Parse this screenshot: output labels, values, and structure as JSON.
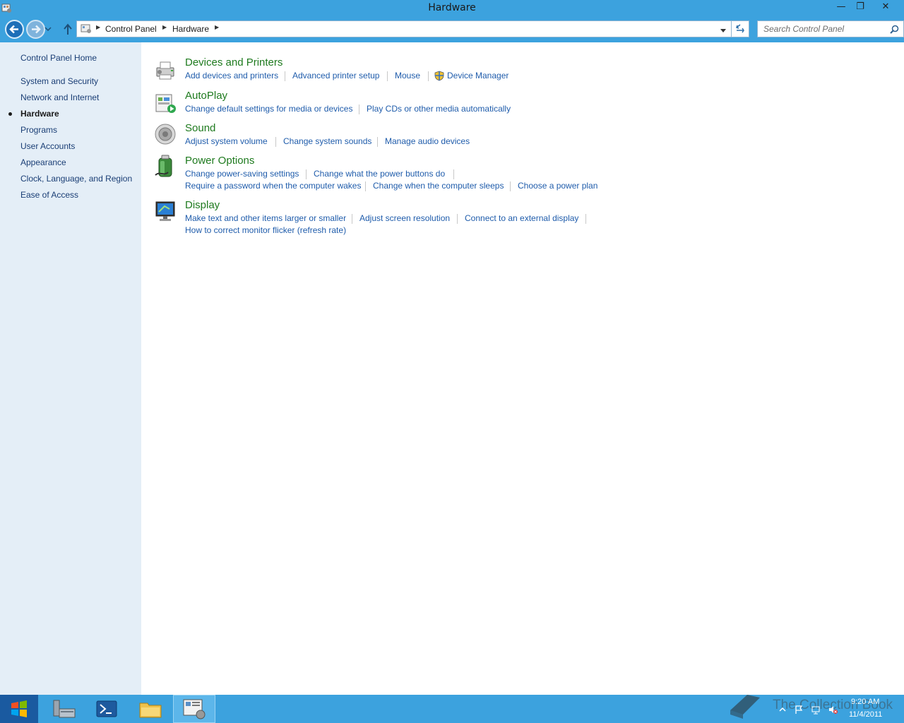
{
  "window": {
    "title": "Hardware",
    "minimize_glyph": "—",
    "maximize_glyph": "❐",
    "close_glyph": "✕"
  },
  "address": {
    "crumbs": [
      "Control Panel",
      "Hardware"
    ],
    "search_placeholder": "Search Control Panel"
  },
  "sidebar": {
    "home": "Control Panel Home",
    "items": [
      {
        "label": "System and Security"
      },
      {
        "label": "Network and Internet"
      },
      {
        "label": "Hardware",
        "active": true
      },
      {
        "label": "Programs"
      },
      {
        "label": "User Accounts"
      },
      {
        "label": "Appearance"
      },
      {
        "label": "Clock, Language, and Region"
      },
      {
        "label": "Ease of Access"
      }
    ]
  },
  "categories": [
    {
      "title": "Devices and Printers",
      "icon": "devices-printers-icon",
      "links": [
        "Add devices and printers",
        "Advanced printer setup",
        "Mouse",
        "Device Manager"
      ]
    },
    {
      "title": "AutoPlay",
      "icon": "autoplay-icon",
      "links": [
        "Change default settings for media or devices",
        "Play CDs or other media automatically"
      ]
    },
    {
      "title": "Sound",
      "icon": "speaker-icon",
      "links": [
        "Adjust system volume",
        "Change system sounds",
        "Manage audio devices"
      ]
    },
    {
      "title": "Power Options",
      "icon": "battery-icon",
      "links": [
        "Change power-saving settings",
        "Change what the power buttons do",
        "Require a password when the computer wakes",
        "Change when the computer sleeps",
        "Choose a power plan"
      ]
    },
    {
      "title": "Display",
      "icon": "monitor-icon",
      "links": [
        "Make text and other items larger or smaller",
        "Adjust screen resolution",
        "Connect to an external display",
        "How to correct monitor flicker (refresh rate)"
      ]
    }
  ],
  "taskbar": {
    "clock_time": "9:20 AM",
    "clock_date": "11/4/2011",
    "watermark": "The Collection Book"
  },
  "colors": {
    "chrome": "#3ca2de",
    "sidebar": "#e4eef7",
    "category_title": "#1e7a1e",
    "link": "#1f5cab"
  }
}
